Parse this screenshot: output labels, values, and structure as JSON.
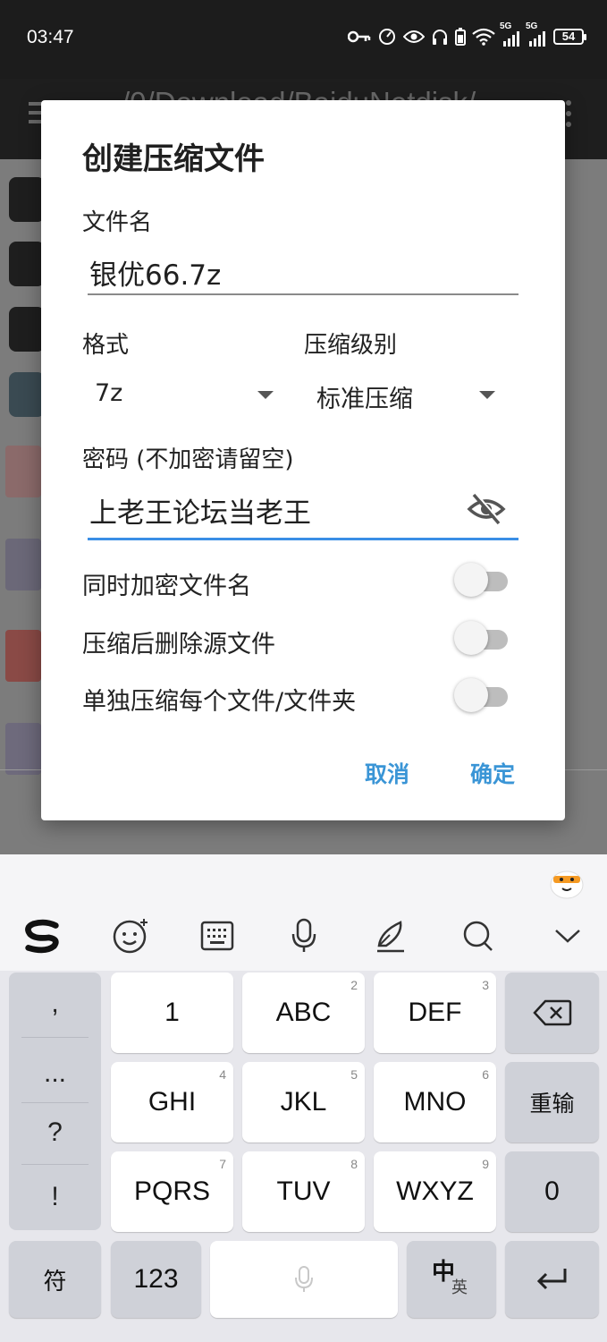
{
  "status_bar": {
    "time": "03:47",
    "signal1": "5G",
    "signal2": "5G",
    "battery": "54"
  },
  "app": {
    "path": "/0/Download/BaiduNetdisk/"
  },
  "dialog": {
    "title": "创建压缩文件",
    "filename_label": "文件名",
    "filename_value": "银优66.7z",
    "format_label": "格式",
    "format_value": "7z",
    "level_label": "压缩级别",
    "level_value": "标准压缩",
    "password_label": "密码 (不加密请留空)",
    "password_value": "上老王论坛当老王",
    "toggles": [
      {
        "label": "同时加密文件名",
        "on": false
      },
      {
        "label": "压缩后删除源文件",
        "on": false
      },
      {
        "label": "单独压缩每个文件/文件夹",
        "on": false
      }
    ],
    "cancel": "取消",
    "confirm": "确定"
  },
  "keyboard": {
    "toolbar": [
      "logo",
      "emoji-icon",
      "keyboard-layout-icon",
      "microphone-icon",
      "handwriting-icon",
      "search-icon",
      "collapse-icon"
    ],
    "side_keys": [
      ",",
      "...",
      "?",
      "!"
    ],
    "keys": {
      "k1": "1",
      "k2": "ABC",
      "k3": "DEF",
      "k4": "GHI",
      "k5": "JKL",
      "k6": "MNO",
      "k7": "PQRS",
      "k8": "TUV",
      "k9": "WXYZ",
      "n2": "2",
      "n3": "3",
      "n4": "4",
      "n5": "5",
      "n6": "6",
      "n7": "7",
      "n8": "8",
      "n9": "9"
    },
    "reenter": "重输",
    "zero": "0",
    "symbol": "符",
    "num": "123",
    "lang_zh": "中",
    "lang_en": "英"
  },
  "colors": {
    "accent": "#3a95d6",
    "focus_underline": "#3a8ee6"
  }
}
